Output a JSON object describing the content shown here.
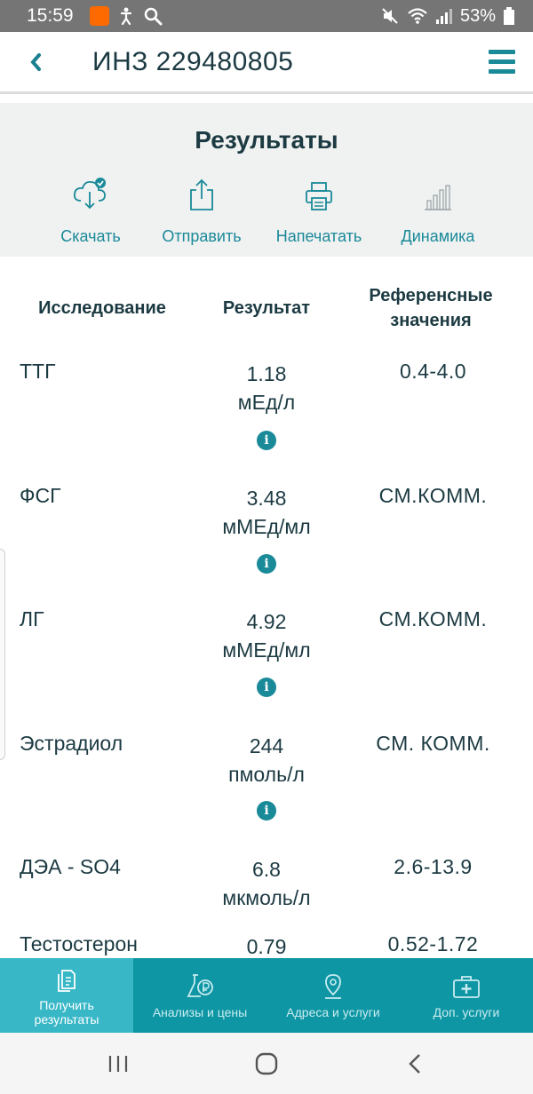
{
  "status_bar": {
    "time": "15:59",
    "battery": "53%",
    "icons": [
      "aliexpress-icon",
      "accessibility-icon",
      "search-icon",
      "mute-icon",
      "wifi-icon",
      "signal-icon",
      "battery-icon"
    ]
  },
  "header": {
    "title": "ИНЗ 229480805",
    "back_icon": "chevron-left-icon",
    "menu_icon": "hamburger-menu-icon"
  },
  "results_panel": {
    "title": "Результаты",
    "actions": [
      {
        "label": "Скачать",
        "icon": "cloud-download-icon"
      },
      {
        "label": "Отправить",
        "icon": "share-icon"
      },
      {
        "label": "Напечатать",
        "icon": "printer-icon"
      },
      {
        "label": "Динамика",
        "icon": "bar-chart-icon"
      }
    ]
  },
  "table": {
    "headers": {
      "study": "Исследование",
      "result": "Результат",
      "reference_line1": "Референсные",
      "reference_line2": "значения"
    },
    "rows": [
      {
        "name": "ТТГ",
        "value": "1.18",
        "unit": "мЕд/л",
        "reference": "0.4-4.0",
        "info": "i"
      },
      {
        "name": "ФСГ",
        "value": "3.48",
        "unit": "мМЕд/мл",
        "reference": "СМ.КОММ.",
        "info": "i"
      },
      {
        "name": "ЛГ",
        "value": "4.92",
        "unit": "мМЕд/мл",
        "reference": "СМ.КОММ.",
        "info": "i"
      },
      {
        "name": "Эстрадиол",
        "value": "244",
        "unit": "пмоль/л",
        "reference": "СМ. КОММ.",
        "info": "i"
      },
      {
        "name": "ДЭА - SO4",
        "value": "6.8",
        "unit": "мкмоль/л",
        "reference": "2.6-13.9",
        "info": ""
      },
      {
        "name": "Тестостерон",
        "value": "0.79",
        "unit": "",
        "reference": "0.52-1.72",
        "info": ""
      }
    ]
  },
  "bottom_nav": {
    "items": [
      {
        "label_line1": "Получить",
        "label_line2": "результаты",
        "icon": "documents-icon",
        "active": true
      },
      {
        "label_line1": "Анализы и цены",
        "label_line2": "",
        "icon": "flask-ruble-icon",
        "active": false
      },
      {
        "label_line1": "Адреса и услуги",
        "label_line2": "",
        "icon": "map-pin-icon",
        "active": false
      },
      {
        "label_line1": "Доп. услуги",
        "label_line2": "",
        "icon": "medical-kit-icon",
        "active": false
      }
    ]
  },
  "system_nav": {
    "icons": [
      "recent-apps-icon",
      "home-icon",
      "back-icon"
    ]
  },
  "colors": {
    "accent": "#1a8a99",
    "nav_bg": "#0e96a4",
    "nav_active": "#38b7c7",
    "status_bar": "#757575",
    "panel_bg": "#f0f1f1",
    "text_dark": "#1c3a42"
  }
}
